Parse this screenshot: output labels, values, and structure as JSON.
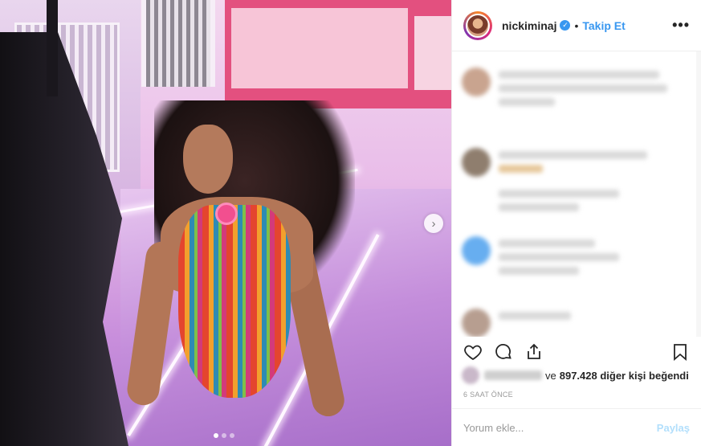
{
  "post": {
    "image_alt_icon": "photo-carousel",
    "carousel": {
      "current_index": 1,
      "total": 3
    }
  },
  "header": {
    "username": "nickiminaj",
    "verified_icon": "verified-badge-icon",
    "separator": "•",
    "follow_label": "Takip Et",
    "more_label": "•••"
  },
  "actions": {
    "like_icon": "heart-icon",
    "comment_icon": "comment-icon",
    "share_icon": "share-icon",
    "save_icon": "bookmark-icon"
  },
  "likes": {
    "prefix": "ve",
    "count_text": "897.428 diğer kişi beğendi"
  },
  "timestamp": "6 SAAT ÖNCE",
  "comment_box": {
    "placeholder": "Yorum ekle...",
    "post_label": "Paylaş"
  },
  "colors": {
    "accent": "#3897f0",
    "post_disabled": "#b2dffc",
    "muted": "#999999"
  }
}
